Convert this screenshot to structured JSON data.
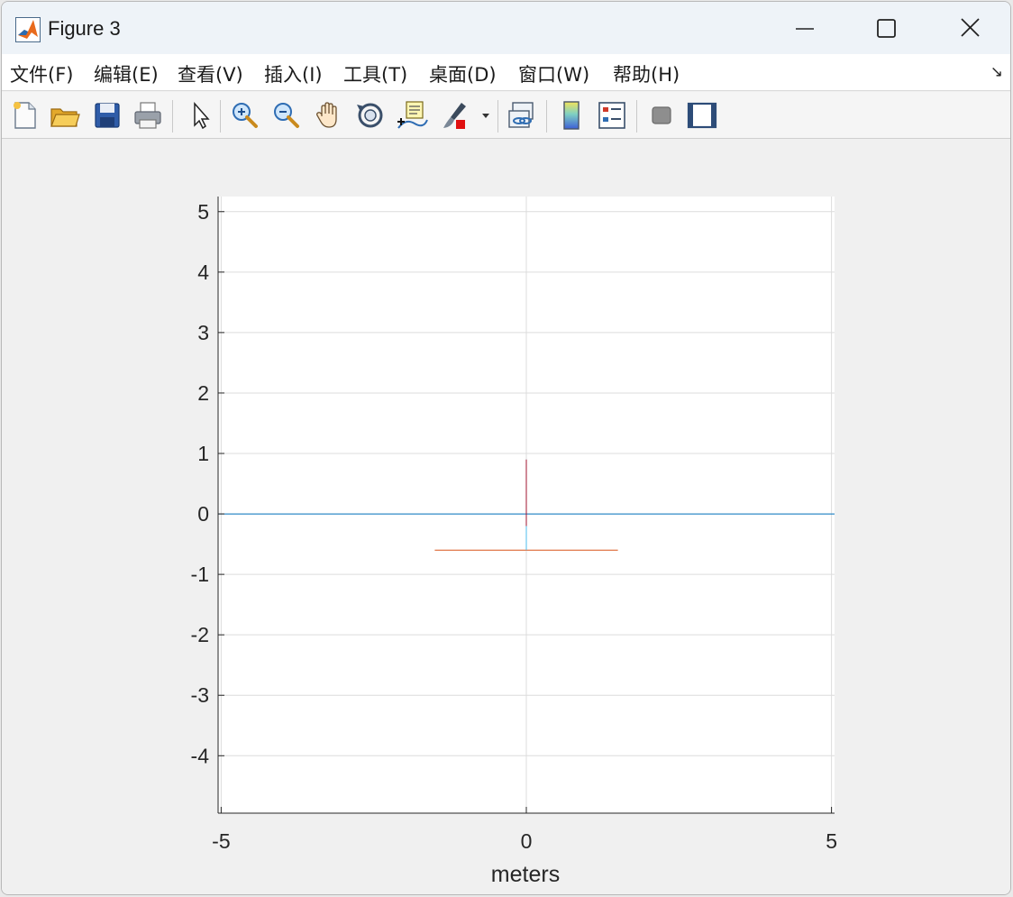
{
  "window": {
    "title": "Figure 3"
  },
  "menu": [
    {
      "label": "文件(F)"
    },
    {
      "label": "编辑(E)"
    },
    {
      "label": "查看(V)"
    },
    {
      "label": "插入(I)"
    },
    {
      "label": "工具(T)"
    },
    {
      "label": "桌面(D)"
    },
    {
      "label": "窗口(W)"
    },
    {
      "label": "帮助(H)"
    }
  ],
  "menu_dock_icon": "dock-arrow-icon",
  "toolbar": [
    "new-figure-icon",
    "open-file-icon",
    "save-icon",
    "print-icon",
    "pointer-icon",
    "zoom-in-icon",
    "zoom-out-icon",
    "pan-icon",
    "rotate-3d-icon",
    "data-tips-icon",
    "brush-icon",
    "link-plot-icon",
    "colorbar-icon",
    "legend-icon",
    "hide-plot-tools-icon",
    "show-plot-tools-icon"
  ],
  "chart_data": {
    "type": "line",
    "title": "",
    "xlabel": "meters",
    "ylabel": "",
    "xlim": [
      -5.05,
      5.05
    ],
    "ylim": [
      -4.95,
      5.25
    ],
    "xticks": [
      "-5",
      "0",
      "5"
    ],
    "yticks": [
      "-4",
      "-3",
      "-2",
      "-1",
      "0",
      "1",
      "2",
      "3",
      "4",
      "5"
    ],
    "grid": true,
    "series": [
      {
        "color": "#0072bd",
        "x": [
          -5.05,
          5.05
        ],
        "y": [
          0,
          0
        ]
      },
      {
        "color": "#d95319",
        "x": [
          -1.5,
          1.5
        ],
        "y": [
          -0.6,
          -0.6
        ]
      },
      {
        "color": "#4dbeee",
        "x": [
          0,
          0
        ],
        "y": [
          0.9,
          -0.6
        ]
      },
      {
        "color": "#a2142f",
        "x": [
          0,
          0
        ],
        "y": [
          0.9,
          -0.2
        ]
      }
    ]
  }
}
